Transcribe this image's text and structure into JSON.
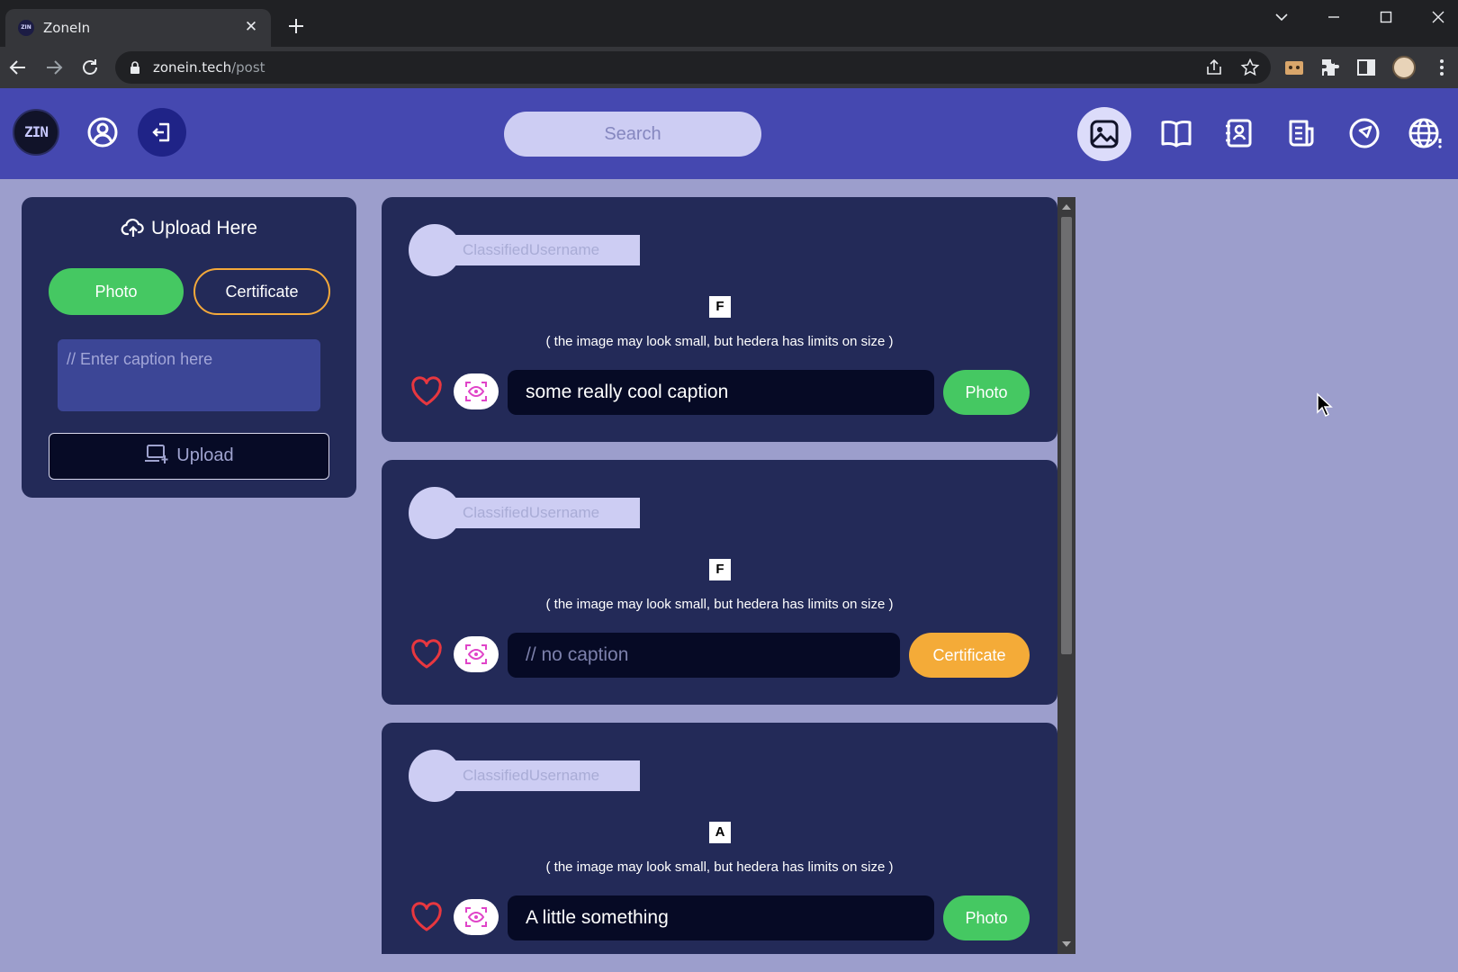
{
  "browser": {
    "tab_title": "ZoneIn",
    "favicon_text": "ZIN",
    "url_host": "zonein.tech",
    "url_path": "/post"
  },
  "header": {
    "logo_text": "ZIN",
    "search_placeholder": "Search"
  },
  "upload_panel": {
    "title": "Upload Here",
    "photo_label": "Photo",
    "certificate_label": "Certificate",
    "caption_placeholder": "// Enter caption here",
    "upload_label": "Upload"
  },
  "posts": [
    {
      "username": "ClassifiedUsername",
      "image_letter": "F",
      "note": "( the image may look small, but hedera has limits on size )",
      "caption": "some really cool caption",
      "type": "Photo"
    },
    {
      "username": "ClassifiedUsername",
      "image_letter": "F",
      "note": "( the image may look small, but hedera has limits on size )",
      "caption": "// no caption",
      "type": "Certificate"
    },
    {
      "username": "ClassifiedUsername",
      "image_letter": "A",
      "note": "( the image may look small, but hedera has limits on size )",
      "caption": "A little something",
      "type": "Photo"
    }
  ],
  "colors": {
    "page_bg": "#9c9ecc",
    "header_bg": "#4548b0",
    "card_bg": "#232a58",
    "photo_green": "#45c862",
    "certificate_orange": "#f4ab38",
    "like_red": "#e8373f",
    "scan_pink": "#e044c8"
  },
  "icons": {
    "header_left": [
      "user-circle-icon",
      "logout-icon"
    ],
    "header_nav": [
      "image-icon",
      "book-open-icon",
      "contacts-icon",
      "article-icon",
      "compass-send-icon",
      "globe-icon"
    ],
    "post_actions": [
      "heart-icon",
      "scan-eye-icon"
    ]
  }
}
